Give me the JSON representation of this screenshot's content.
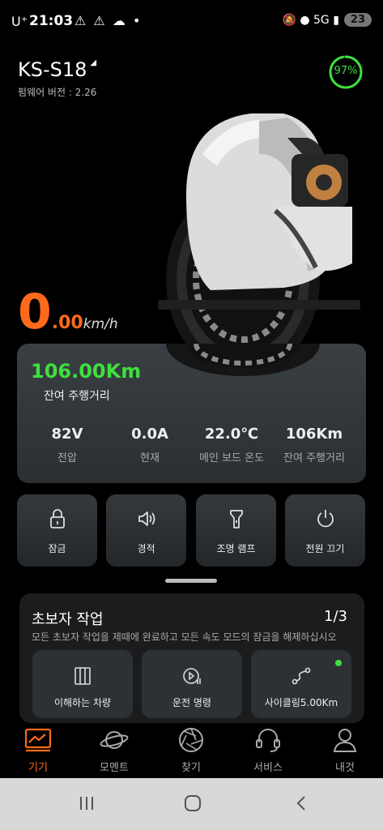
{
  "status_bar": {
    "carrier": "U⁺",
    "time": "21:03",
    "left_icons": "⚠ ⚠ ☁ •",
    "right_icons": "🔕 ● 5G ▮",
    "battery": "23"
  },
  "device": {
    "model": "KS-S18",
    "firmware": "펌웨어 버전 : 2.26",
    "battery_percent": "97%",
    "battery_fraction": 0.97
  },
  "speed": {
    "integer": "0",
    "decimal": ".00",
    "unit": "km/h"
  },
  "info": {
    "remaining_distance": "106.00Km",
    "remaining_label": "잔여 주행거리",
    "stats": [
      {
        "value": "82V",
        "label": "전압"
      },
      {
        "value": "0.0A",
        "label": "현재"
      },
      {
        "value": "22.0℃",
        "label": "메인 보드 온도"
      },
      {
        "value": "106Km",
        "label": "잔여 주행거리"
      }
    ]
  },
  "controls": [
    {
      "label": "잠금",
      "icon": "lock-icon"
    },
    {
      "label": "경적",
      "icon": "horn-icon"
    },
    {
      "label": "조명 램프",
      "icon": "flashlight-icon"
    },
    {
      "label": "전원 끄기",
      "icon": "power-icon"
    }
  ],
  "tasks": {
    "title": "초보자 작업",
    "count": "1/3",
    "description": "모든 초보자 작업을 제때에 완료하고 모든 속도 모드의 잠금을 해제하십시오",
    "items": [
      {
        "label": "이해하는 차량",
        "icon": "vehicle-icon"
      },
      {
        "label": "운전 명령",
        "icon": "video-icon"
      },
      {
        "label": "사이클링5.00Km",
        "icon": "route-icon"
      }
    ],
    "accent": "#3ee03e"
  },
  "nav": [
    {
      "label": "기기",
      "icon": "device-icon",
      "active": true
    },
    {
      "label": "모멘트",
      "icon": "planet-icon",
      "active": false
    },
    {
      "label": "찾기",
      "icon": "aperture-icon",
      "active": false
    },
    {
      "label": "서비스",
      "icon": "headset-icon",
      "active": false
    },
    {
      "label": "내것",
      "icon": "user-icon",
      "active": false
    }
  ],
  "colors": {
    "accent": "#ff6a1a",
    "good": "#3ee03e"
  }
}
